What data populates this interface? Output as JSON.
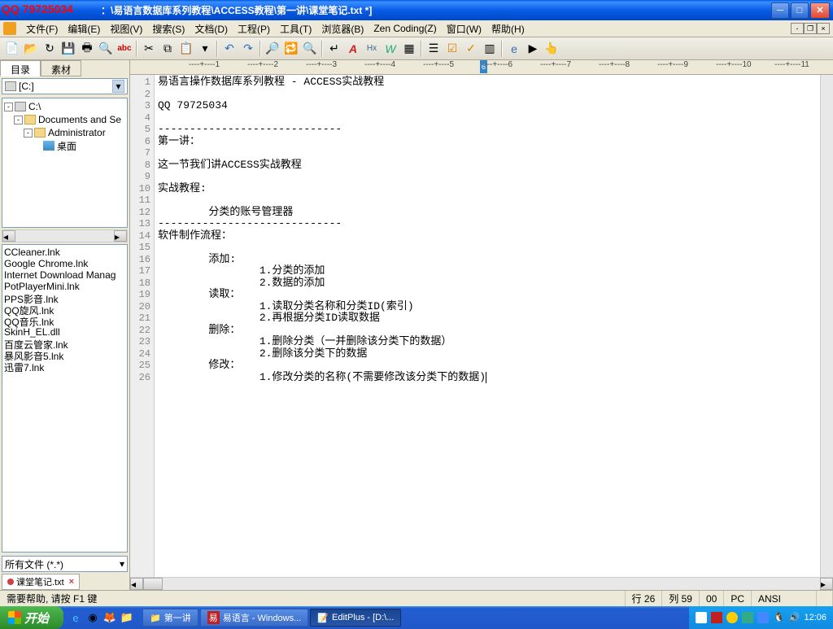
{
  "watermark": "QQ 79725034",
  "title": "：\\易语言数据库系列教程\\ACCESS教程\\第一讲\\课堂笔记.txt *]",
  "menu": {
    "file": "文件(F)",
    "edit": "编辑(E)",
    "view": "视图(V)",
    "search": "搜索(S)",
    "document": "文档(D)",
    "project": "工程(P)",
    "tools": "工具(T)",
    "browser": "浏览器(B)",
    "zen": "Zen Coding(Z)",
    "window": "窗口(W)",
    "help": "帮助(H)"
  },
  "sidebar": {
    "tabs": {
      "dir": "目录",
      "material": "素材"
    },
    "drive": "[C:]",
    "tree": {
      "root": "C:\\",
      "docs": "Documents and Se",
      "admin": "Administrator",
      "desktop": "桌面"
    },
    "files": [
      "CCleaner.lnk",
      "Google Chrome.lnk",
      "Internet Download Manag",
      "PotPlayerMini.lnk",
      "PPS影音.lnk",
      "QQ旋风.lnk",
      "QQ音乐.lnk",
      "SkinH_EL.dll",
      "百度云管家.lnk",
      "暴风影音5.lnk",
      "迅雷7.lnk"
    ],
    "filter": "所有文件 (*.*)",
    "doctab": "课堂笔记.txt"
  },
  "ruler_active": "6",
  "lines": [
    "易语言操作数据库系列教程 - ACCESS实战教程",
    "",
    "QQ 79725034",
    "",
    "-----------------------------",
    "第一讲：",
    "",
    "这一节我们讲ACCESS实战教程",
    "",
    "实战教程:",
    "",
    "        分类的账号管理器",
    "-----------------------------",
    "软件制作流程：",
    "",
    "        添加:",
    "                1.分类的添加",
    "                2.数据的添加",
    "        读取：",
    "                1.读取分类名称和分类ID(索引)",
    "                2.再根据分类ID读取数据",
    "        删除：",
    "                1.删除分类（一并删除该分类下的数据）",
    "                2.删除该分类下的数据",
    "        修改：",
    "                1.修改分类的名称(不需要修改该分类下的数据)"
  ],
  "status": {
    "help": "需要帮助, 请按 F1 键",
    "line_lbl": "行",
    "line_val": "26",
    "col_lbl": "列",
    "col_val": "59",
    "extra": "00",
    "mode": "PC",
    "encoding": "ANSI"
  },
  "taskbar": {
    "start": "开始",
    "tasks": {
      "folder": "第一讲",
      "yi": "易语言 - Windows...",
      "ep": "EditPlus - [D:\\..."
    },
    "clock": "12:06"
  }
}
